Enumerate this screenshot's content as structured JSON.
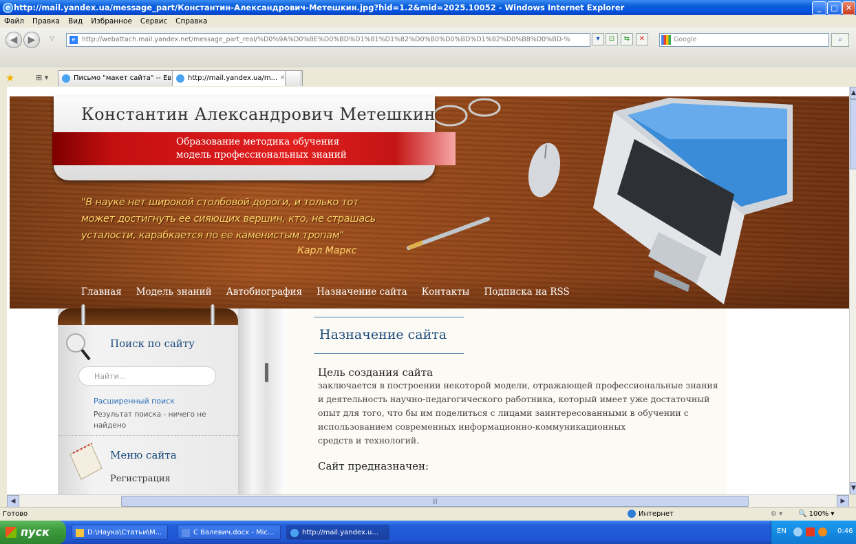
{
  "window": {
    "title": "http://mail.yandex.ua/message_part/Константин-Александрович-Метешкин.jpg?hid=1.2&mid=2025.10052 - Windows Internet Explorer",
    "buttons": {
      "minimize": "_",
      "maximize": "□",
      "close": "✕"
    }
  },
  "menu": [
    "Файл",
    "Правка",
    "Вид",
    "Избранное",
    "Сервис",
    "Справка"
  ],
  "toolbar": {
    "address": "http://webattach.mail.yandex.net/message_part_real/%D0%9A%D0%BE%D0%BD%D1%81%D1%82%D0%B0%D0%BD%D1%82%D0%B8%D0%BD-%",
    "search_placeholder": "Google",
    "go": "⌕"
  },
  "tabs": [
    {
      "label": "Письмо \"макет сайта\" -- Евг..."
    },
    {
      "label": "http://mail.yandex.ua/m..."
    }
  ],
  "site": {
    "name": "Константин  Александрович  Метешкин",
    "ribbon_line1": "Образование  методика обучения",
    "ribbon_line2": "модель профессиональных знаний",
    "quote_lines": [
      "\"В науке нет широкой столбовой дороги, и только тот",
      "может достигнуть ее сияющих вершин, кто, не страшась",
      "усталости, карабкается по ее каменистым тропам\""
    ],
    "quote_author": "Карл Маркс",
    "nav": [
      "Главная",
      "Модель знаний",
      "Автобиография",
      "Назначение сайта",
      "Контакты",
      "Подписка на RSS"
    ]
  },
  "sidebar": {
    "search_title": "Поиск по сайту",
    "search_placeholder": "Найти...",
    "advanced_search": "Расширенный поиск",
    "result_line1": "Результат поиска - ничего не",
    "result_line2": "найдено",
    "menu_title": "Меню сайта",
    "menu_item": "Регистрация"
  },
  "content": {
    "title": "Назначение сайта",
    "goal_heading": "Цель создания сайта",
    "goal_lines": [
      "заключается в построении некоторой модели, отражающей профессиональные знания",
      "и деятельность научно-педагогического работника, который имеет уже достаточный",
      "опыт для того, что бы им поделиться с лицами заинтересованными в обучении с",
      "использованием современных информационно-коммуникационных",
      "средств и технологий."
    ],
    "purpose_heading": "Сайт предназначен:"
  },
  "status": {
    "text": "Готово",
    "zone": "Интернет",
    "zoom": "100%"
  },
  "taskbar": {
    "start": "пуск",
    "tasks": [
      "D:\\Наука\\Статьи\\М...",
      "С Валевич.docx - Mic...",
      "http://mail.yandex.u..."
    ],
    "lang": "EN",
    "time": "0:46"
  },
  "colors": {
    "ie_blue": "#0554e3",
    "nav_text": "#ffffff",
    "quote": "#ffd36a",
    "link": "#2a6dba",
    "heading": "#1b4a7a"
  }
}
